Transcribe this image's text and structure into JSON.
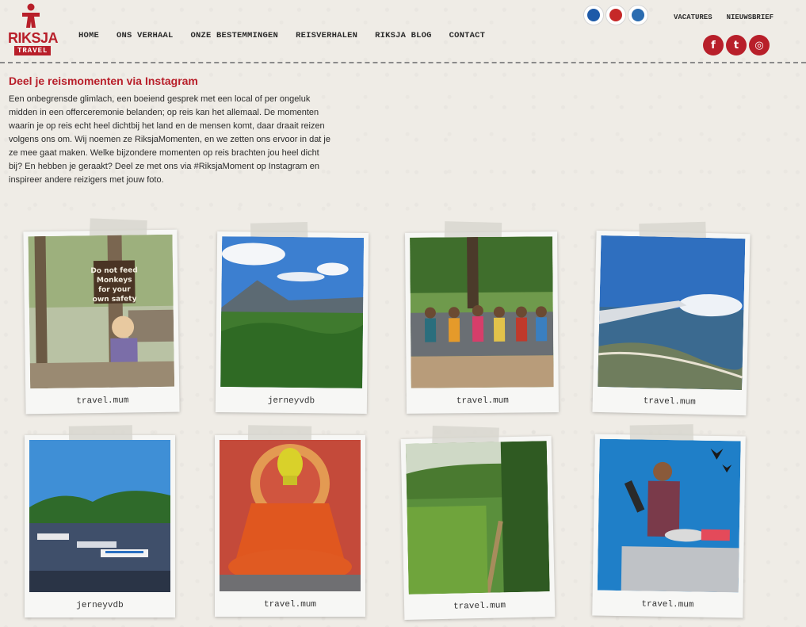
{
  "brand": {
    "name": "RIKSJA",
    "tag": "TRAVEL"
  },
  "nav": [
    "HOME",
    "ONS VERHAAL",
    "ONZE BESTEMMINGEN",
    "REISVERHALEN",
    "RIKSJA BLOG",
    "CONTACT"
  ],
  "top_links": [
    "VACATURES",
    "NIEUWSBRIEF"
  ],
  "social": [
    {
      "icon": "facebook-icon",
      "glyph": "f"
    },
    {
      "icon": "twitter-icon",
      "glyph": "t"
    },
    {
      "icon": "instagram-icon",
      "glyph": "◎"
    }
  ],
  "badges": [
    {
      "icon": "anvr-badge",
      "color": "#1e5aa8"
    },
    {
      "icon": "sgr-badge",
      "color": "#c62828"
    },
    {
      "icon": "calamiteitenfonds-badge",
      "color": "#2b6cb0"
    }
  ],
  "page_title": "Deel je reismomenten via Instagram",
  "intro": "Een onbegrensde glimlach, een boeiend gesprek met een local of per ongeluk midden in een offerceremonie belanden; op reis kan het allemaal. De momenten waarin je op reis echt heel dichtbij het land en de mensen komt, daar draait reizen volgens ons om. Wij noemen ze RiksjaMomenten, en we zetten ons ervoor in dat je ze mee gaat maken. Welke bijzondere momenten op reis brachten jou heel dicht bij? En hebben je geraakt? Deel ze met ons via #RiksjaMoment op Instagram en inspireer andere reizigers met jouw foto.",
  "photos": [
    {
      "caption": "travel.mum",
      "sign": "Do not feed Monkeys for your own safety"
    },
    {
      "caption": "jerneyvdb"
    },
    {
      "caption": "travel.mum"
    },
    {
      "caption": "travel.mum"
    },
    {
      "caption": "jerneyvdb"
    },
    {
      "caption": "travel.mum"
    },
    {
      "caption": "travel.mum"
    },
    {
      "caption": "travel.mum"
    }
  ],
  "colors": {
    "accent": "#b81f2a",
    "background": "#efece6",
    "text": "#2b2b2b"
  }
}
